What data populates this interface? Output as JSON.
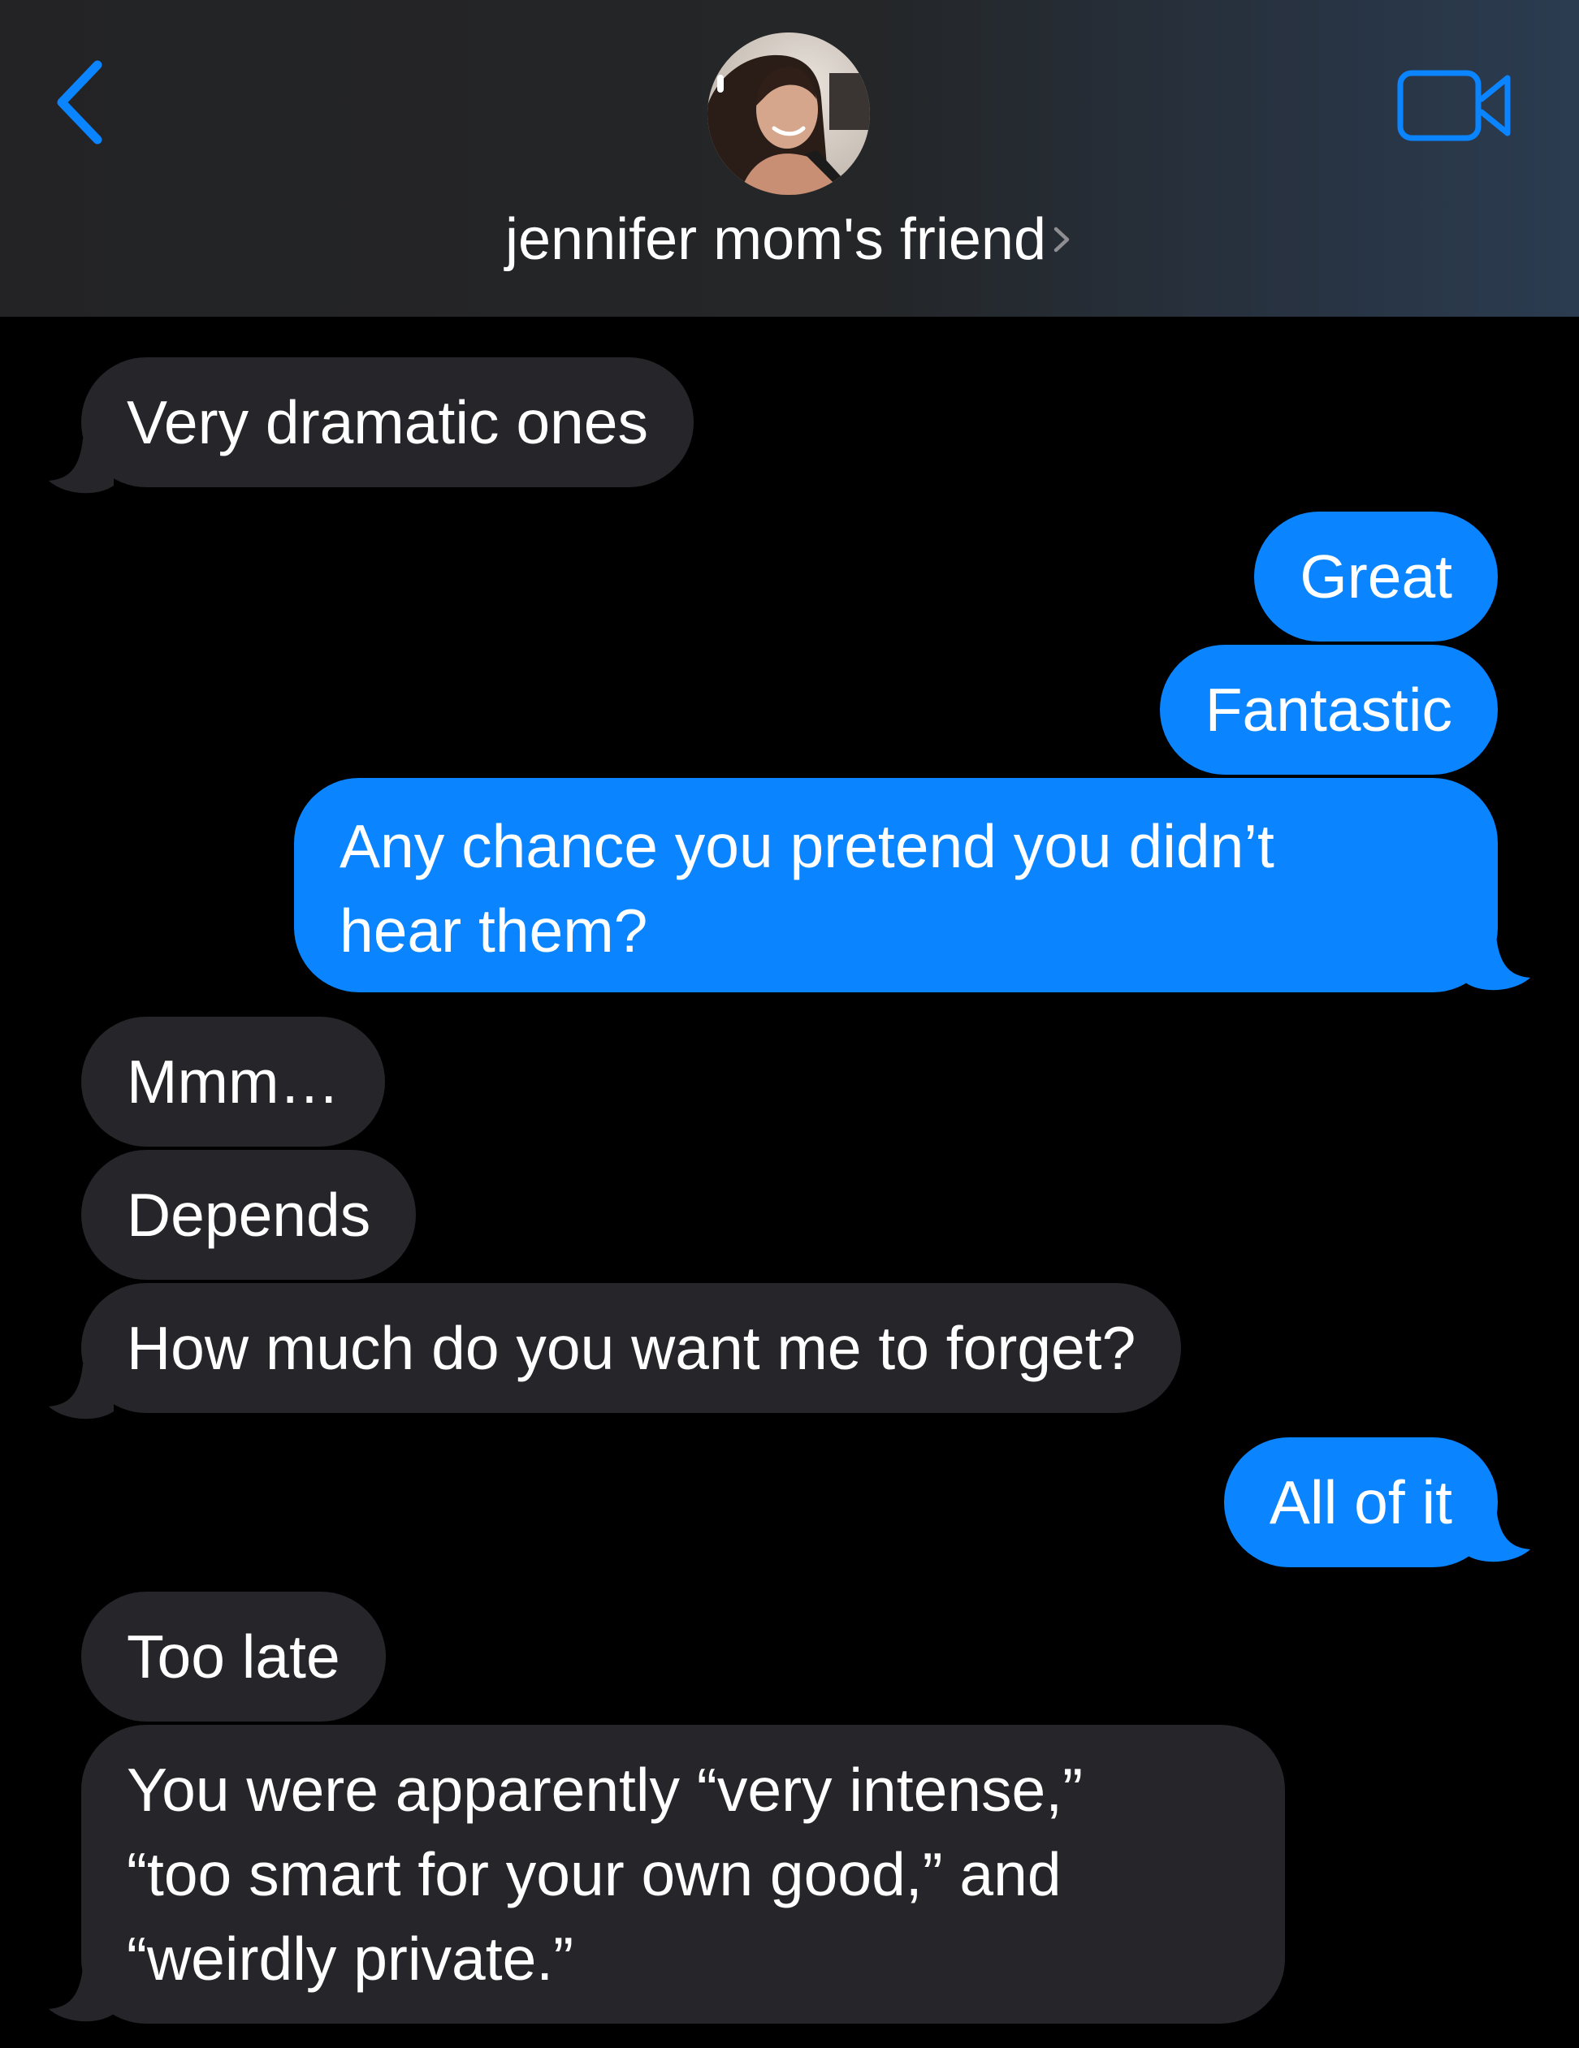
{
  "header": {
    "contact_name": "jennifer mom's friend",
    "accent_color": "#0a84ff",
    "back_icon": "chevron-left-icon",
    "video_icon": "video-camera-icon",
    "name_chevron_icon": "chevron-right-icon"
  },
  "messages": [
    {
      "from": "them",
      "text": "Very dramatic ones"
    },
    {
      "from": "me",
      "text": "Great"
    },
    {
      "from": "me",
      "text": "Fantastic"
    },
    {
      "from": "me",
      "text": "Any chance you pretend you didn’t hear them?",
      "lines": [
        "Any chance you pretend you didn’t",
        "hear them?"
      ]
    },
    {
      "from": "them",
      "text": "Mmm…"
    },
    {
      "from": "them",
      "text": "Depends"
    },
    {
      "from": "them",
      "text": "How much do you want me to forget?"
    },
    {
      "from": "me",
      "text": "All of it"
    },
    {
      "from": "them",
      "text": "Too late"
    },
    {
      "from": "them",
      "text": "You were apparently “very intense,” “too smart for your own good,” and “weirdly private.”",
      "lines": [
        "You were apparently “very intense,”",
        "“too smart for your own good,” and",
        "“weirdly private.”"
      ]
    }
  ],
  "colors": {
    "incoming_bubble": "#26252a",
    "outgoing_bubble": "#0a84ff",
    "background": "#000000"
  }
}
